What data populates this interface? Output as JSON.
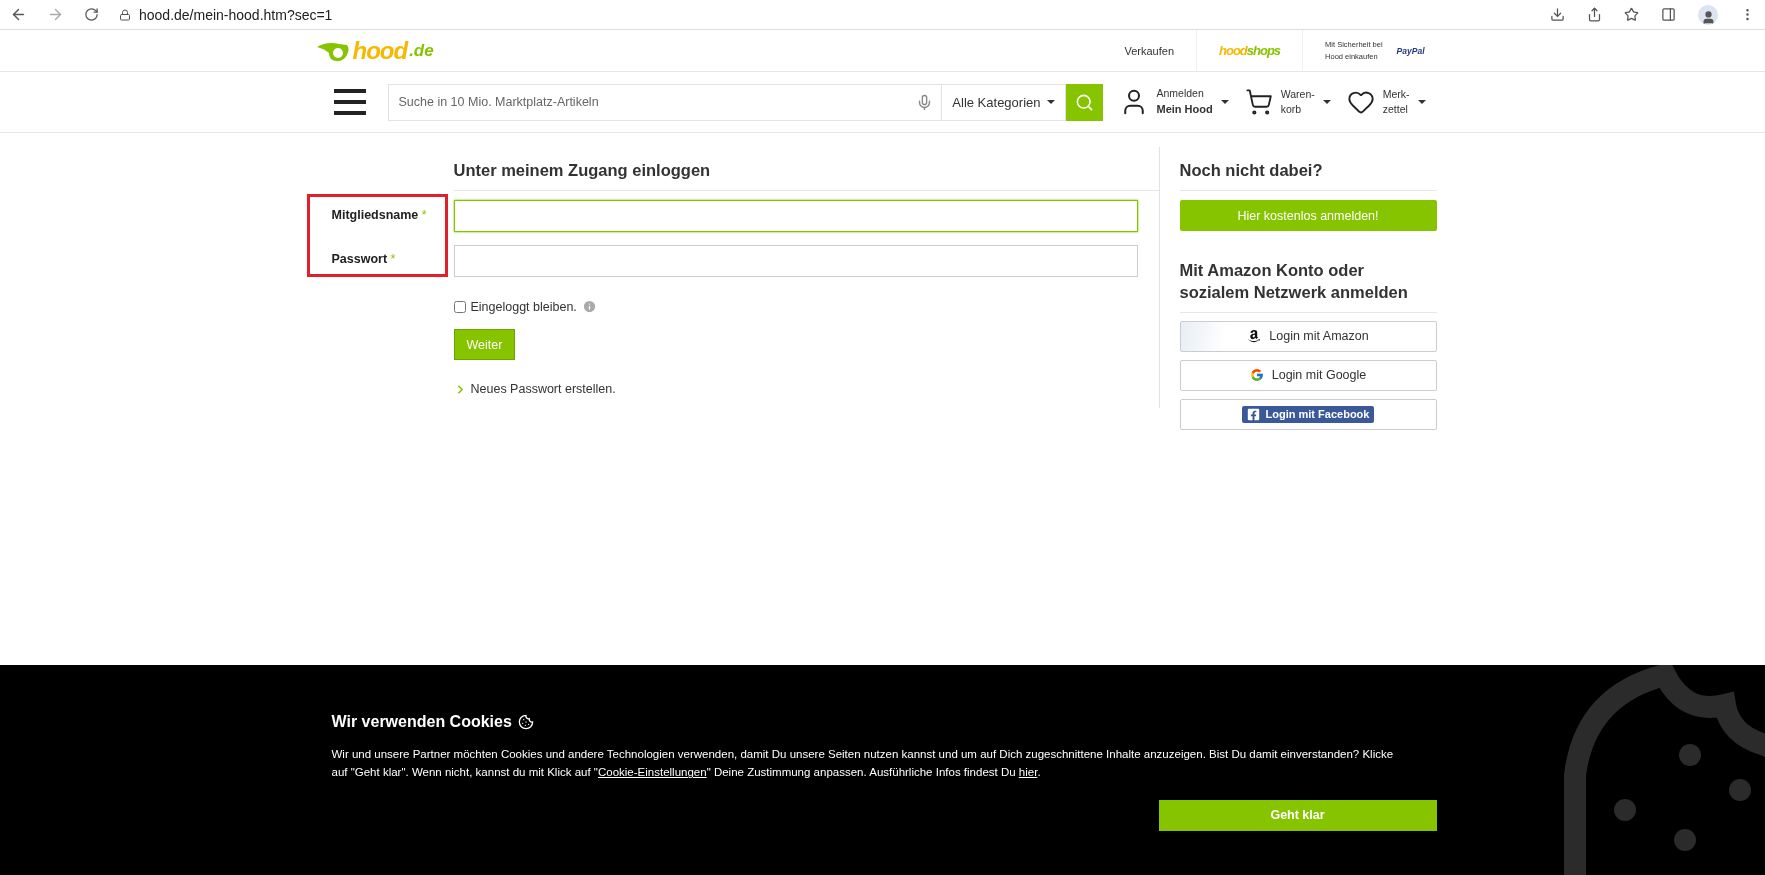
{
  "browser": {
    "url": "hood.de/mein-hood.htm?sec=1"
  },
  "header": {
    "logo": {
      "main": "hood",
      "suffix": ".de"
    },
    "sell": "Verkaufen",
    "shops": {
      "first": "hood",
      "second": "shops"
    },
    "paypal": {
      "note_lines": [
        "Mit Sicherheit bei",
        "Hood einkaufen"
      ],
      "brand": "PayPal"
    }
  },
  "nav": {
    "search": {
      "placeholder": "Suche in 10 Mio. Marktplatz-Artikeln"
    },
    "category": "Alle Kategorien",
    "account": {
      "line1": "Anmelden",
      "line2": "Mein Hood"
    },
    "cart": [
      "Waren-",
      "korb"
    ],
    "wishlist": [
      "Merk-",
      "zettel"
    ]
  },
  "login": {
    "title": "Unter meinem Zugang einloggen",
    "fields": [
      {
        "label": "Mitgliedsname",
        "required_mark": "*",
        "focused": true
      },
      {
        "label": "Passwort",
        "required_mark": "*",
        "focused": false
      }
    ],
    "remember": {
      "label": "Eingeloggt bleiben.",
      "checked": false
    },
    "submit": "Weiter",
    "reset_link": "Neues Passwort erstellen."
  },
  "signup": {
    "title": "Noch nicht dabei?",
    "button": "Hier kostenlos anmelden!"
  },
  "social": {
    "title": "Mit Amazon Konto oder sozialem Netzwerk anmelden",
    "buttons": [
      {
        "kind": "amazon",
        "label": "Login mit Amazon"
      },
      {
        "kind": "google",
        "label": "Login mit Google"
      },
      {
        "kind": "facebook",
        "label": "Login mit Facebook"
      }
    ]
  },
  "cookie": {
    "title": "Wir verwenden Cookies",
    "parts": [
      {
        "kind": "text",
        "text": "Wir und unsere Partner möchten Cookies und andere Technologien verwenden, damit Du unsere Seiten nutzen kannst und um auf Dich zugeschnittene Inhalte anzuzeigen. Bist Du damit einverstanden? Klicke auf \"Geht klar\". Wenn nicht, kannst du mit Klick auf \""
      },
      {
        "kind": "link",
        "text": "Cookie-Einstellungen"
      },
      {
        "kind": "text",
        "text": "\" Deine Zustimmung anpassen. Ausführliche Infos findest Du "
      },
      {
        "kind": "link",
        "text": "hier"
      },
      {
        "kind": "text",
        "text": "."
      }
    ],
    "button": "Geht klar"
  }
}
